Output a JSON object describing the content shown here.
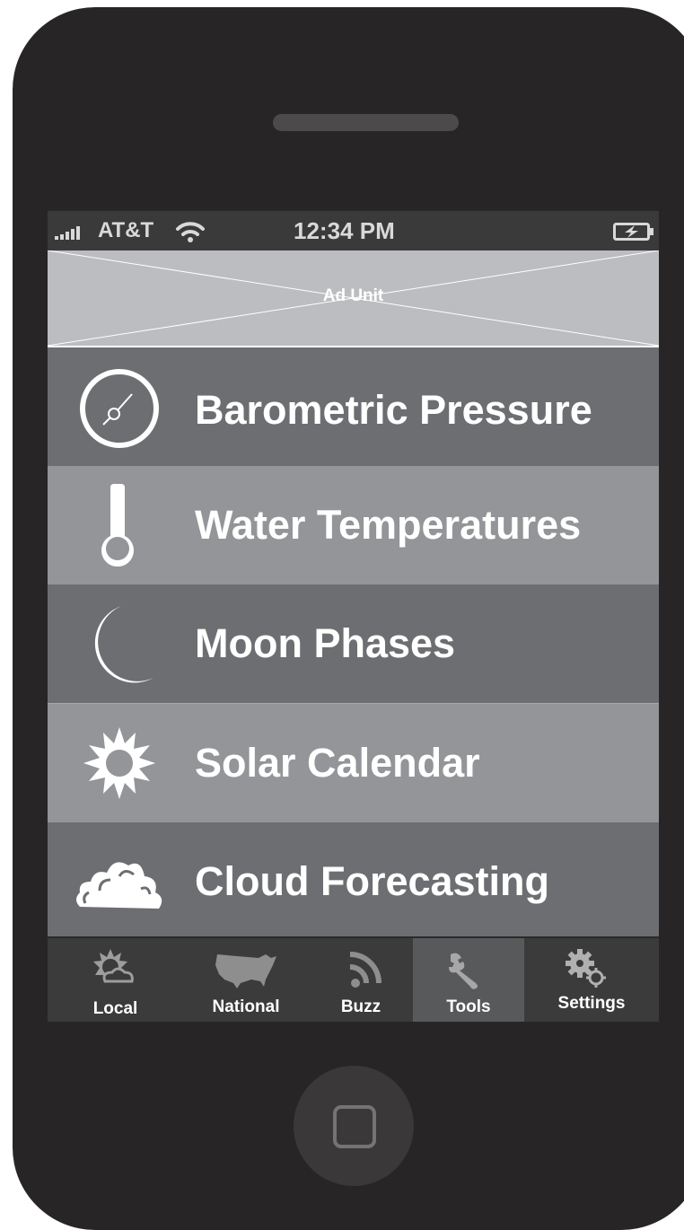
{
  "status_bar": {
    "carrier": "AT&T",
    "time": "12:34 PM",
    "signal_icon": "signal-bars-icon",
    "wifi_icon": "wifi-icon",
    "battery_icon": "battery-charging-icon"
  },
  "ad": {
    "label": "Ad Unit"
  },
  "tools": [
    {
      "label": "Barometric Pressure",
      "icon": "barometer-icon"
    },
    {
      "label": "Water Temperatures",
      "icon": "thermometer-icon"
    },
    {
      "label": "Moon Phases",
      "icon": "moon-icon"
    },
    {
      "label": "Solar Calendar",
      "icon": "sun-icon"
    },
    {
      "label": "Cloud Forecasting",
      "icon": "cloud-icon"
    }
  ],
  "tabbar": {
    "selected": "Tools",
    "tabs": [
      {
        "label": "Local",
        "icon": "sun-cloud-icon"
      },
      {
        "label": "National",
        "icon": "usa-map-icon"
      },
      {
        "label": "Buzz",
        "icon": "rss-icon"
      },
      {
        "label": "Tools",
        "icon": "wrench-icon"
      },
      {
        "label": "Settings",
        "icon": "gears-icon"
      }
    ]
  },
  "colors": {
    "phone_body": "#282526",
    "row_dark": "#6d6e71",
    "row_light": "#939598",
    "tab_active": "#58595b"
  }
}
